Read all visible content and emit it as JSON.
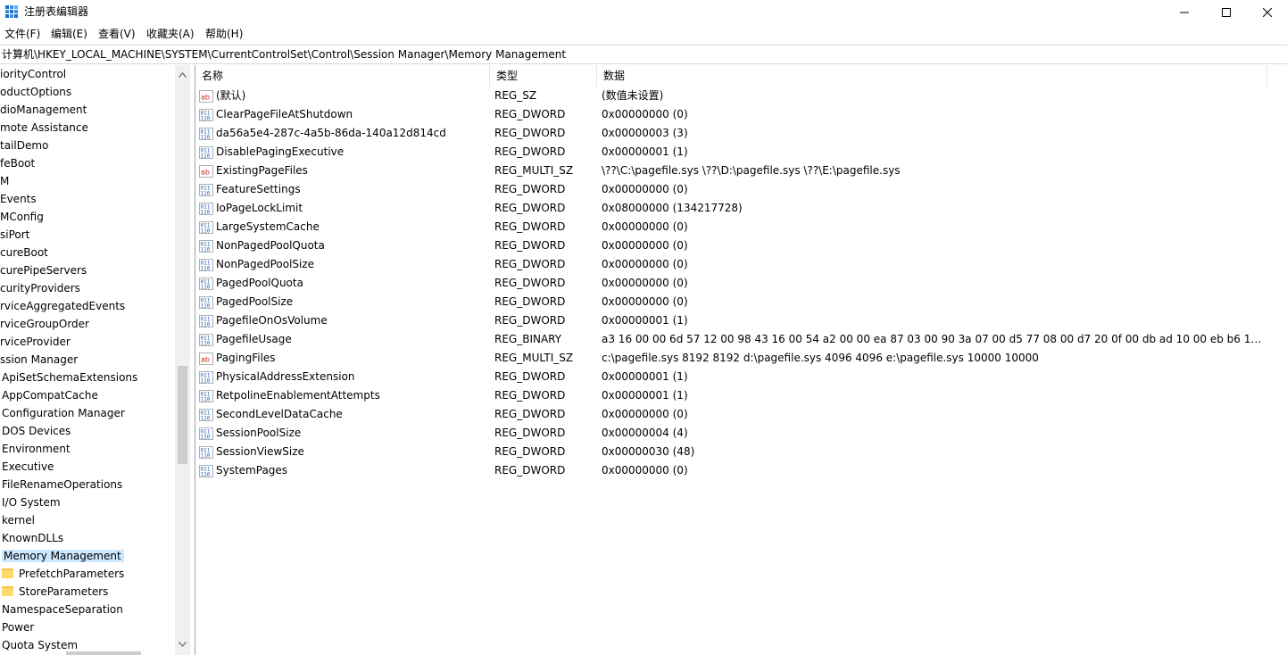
{
  "window": {
    "title": "注册表编辑器",
    "controls": {
      "minimize": "—",
      "maximize": "☐",
      "close": "✕"
    }
  },
  "menu": [
    "文件(F)",
    "编辑(E)",
    "查看(V)",
    "收藏夹(A)",
    "帮助(H)"
  ],
  "address": "计算机\\HKEY_LOCAL_MACHINE\\SYSTEM\\CurrentControlSet\\Control\\Session Manager\\Memory Management",
  "tree": {
    "items": [
      {
        "label": "iorityControl",
        "indent": 0
      },
      {
        "label": "oductOptions",
        "indent": 0
      },
      {
        "label": "dioManagement",
        "indent": 0
      },
      {
        "label": "mote Assistance",
        "indent": 0
      },
      {
        "label": "tailDemo",
        "indent": 0
      },
      {
        "label": "feBoot",
        "indent": 0
      },
      {
        "label": "M",
        "indent": 0
      },
      {
        "label": "Events",
        "indent": 0
      },
      {
        "label": "MConfig",
        "indent": 0
      },
      {
        "label": "siPort",
        "indent": 0
      },
      {
        "label": "cureBoot",
        "indent": 0
      },
      {
        "label": "curePipeServers",
        "indent": 0
      },
      {
        "label": "curityProviders",
        "indent": 0
      },
      {
        "label": "rviceAggregatedEvents",
        "indent": 0
      },
      {
        "label": "rviceGroupOrder",
        "indent": 0
      },
      {
        "label": "rviceProvider",
        "indent": 0
      },
      {
        "label": "ssion Manager",
        "indent": 0
      },
      {
        "label": "ApiSetSchemaExtensions",
        "indent": 1
      },
      {
        "label": "AppCompatCache",
        "indent": 1
      },
      {
        "label": "Configuration Manager",
        "indent": 1
      },
      {
        "label": "DOS Devices",
        "indent": 1
      },
      {
        "label": "Environment",
        "indent": 1
      },
      {
        "label": "Executive",
        "indent": 1
      },
      {
        "label": "FileRenameOperations",
        "indent": 1
      },
      {
        "label": "I/O System",
        "indent": 1
      },
      {
        "label": "kernel",
        "indent": 1
      },
      {
        "label": "KnownDLLs",
        "indent": 1
      },
      {
        "label": "Memory Management",
        "indent": 1,
        "selected": true
      },
      {
        "label": "PrefetchParameters",
        "indent": 2,
        "folder": true
      },
      {
        "label": "StoreParameters",
        "indent": 2,
        "folder": true
      },
      {
        "label": "NamespaceSeparation",
        "indent": 1
      },
      {
        "label": "Power",
        "indent": 1
      },
      {
        "label": "Quota System",
        "indent": 1
      }
    ]
  },
  "list": {
    "columns": {
      "name": "名称",
      "type": "类型",
      "data": "数据"
    },
    "rows": [
      {
        "icon": "string-value-icon",
        "name": "(默认)",
        "type": "REG_SZ",
        "data": "(数值未设置)"
      },
      {
        "icon": "binary-value-icon",
        "name": "ClearPageFileAtShutdown",
        "type": "REG_DWORD",
        "data": "0x00000000 (0)"
      },
      {
        "icon": "binary-value-icon",
        "name": "da56a5e4-287c-4a5b-86da-140a12d814cd",
        "type": "REG_DWORD",
        "data": "0x00000003 (3)"
      },
      {
        "icon": "binary-value-icon",
        "name": "DisablePagingExecutive",
        "type": "REG_DWORD",
        "data": "0x00000001 (1)"
      },
      {
        "icon": "string-value-icon",
        "name": "ExistingPageFiles",
        "type": "REG_MULTI_SZ",
        "data": "\\??\\C:\\pagefile.sys \\??\\D:\\pagefile.sys \\??\\E:\\pagefile.sys"
      },
      {
        "icon": "binary-value-icon",
        "name": "FeatureSettings",
        "type": "REG_DWORD",
        "data": "0x00000000 (0)"
      },
      {
        "icon": "binary-value-icon",
        "name": "IoPageLockLimit",
        "type": "REG_DWORD",
        "data": "0x08000000 (134217728)"
      },
      {
        "icon": "binary-value-icon",
        "name": "LargeSystemCache",
        "type": "REG_DWORD",
        "data": "0x00000000 (0)"
      },
      {
        "icon": "binary-value-icon",
        "name": "NonPagedPoolQuota",
        "type": "REG_DWORD",
        "data": "0x00000000 (0)"
      },
      {
        "icon": "binary-value-icon",
        "name": "NonPagedPoolSize",
        "type": "REG_DWORD",
        "data": "0x00000000 (0)"
      },
      {
        "icon": "binary-value-icon",
        "name": "PagedPoolQuota",
        "type": "REG_DWORD",
        "data": "0x00000000 (0)"
      },
      {
        "icon": "binary-value-icon",
        "name": "PagedPoolSize",
        "type": "REG_DWORD",
        "data": "0x00000000 (0)"
      },
      {
        "icon": "binary-value-icon",
        "name": "PagefileOnOsVolume",
        "type": "REG_DWORD",
        "data": "0x00000001 (1)"
      },
      {
        "icon": "binary-value-icon",
        "name": "PagefileUsage",
        "type": "REG_BINARY",
        "data": "a3 16 00 00 6d 57 12 00 98 43 16 00 54 a2 00 00 ea 87 03 00 90 3a 07 00 d5 77 08 00 d7 20 0f 00 db ad 10 00 eb b6 11 00 ..."
      },
      {
        "icon": "string-value-icon",
        "name": "PagingFiles",
        "type": "REG_MULTI_SZ",
        "data": "c:\\pagefile.sys 8192 8192 d:\\pagefile.sys 4096 4096 e:\\pagefile.sys 10000 10000"
      },
      {
        "icon": "binary-value-icon",
        "name": "PhysicalAddressExtension",
        "type": "REG_DWORD",
        "data": "0x00000001 (1)"
      },
      {
        "icon": "binary-value-icon",
        "name": "RetpolineEnablementAttempts",
        "type": "REG_DWORD",
        "data": "0x00000001 (1)"
      },
      {
        "icon": "binary-value-icon",
        "name": "SecondLevelDataCache",
        "type": "REG_DWORD",
        "data": "0x00000000 (0)"
      },
      {
        "icon": "binary-value-icon",
        "name": "SessionPoolSize",
        "type": "REG_DWORD",
        "data": "0x00000004 (4)"
      },
      {
        "icon": "binary-value-icon",
        "name": "SessionViewSize",
        "type": "REG_DWORD",
        "data": "0x00000030 (48)"
      },
      {
        "icon": "binary-value-icon",
        "name": "SystemPages",
        "type": "REG_DWORD",
        "data": "0x00000000 (0)"
      }
    ]
  },
  "colors": {
    "selection": "#cce8ff",
    "border": "#a0a0a0"
  }
}
